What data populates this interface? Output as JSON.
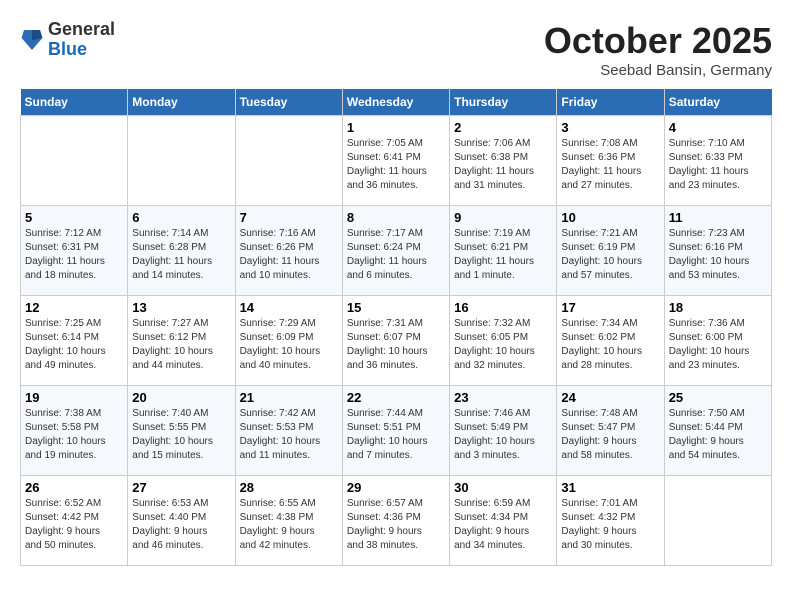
{
  "logo": {
    "general": "General",
    "blue": "Blue"
  },
  "header": {
    "month": "October 2025",
    "location": "Seebad Bansin, Germany"
  },
  "days_of_week": [
    "Sunday",
    "Monday",
    "Tuesday",
    "Wednesday",
    "Thursday",
    "Friday",
    "Saturday"
  ],
  "weeks": [
    [
      {
        "day": "",
        "info": ""
      },
      {
        "day": "",
        "info": ""
      },
      {
        "day": "",
        "info": ""
      },
      {
        "day": "1",
        "info": "Sunrise: 7:05 AM\nSunset: 6:41 PM\nDaylight: 11 hours\nand 36 minutes."
      },
      {
        "day": "2",
        "info": "Sunrise: 7:06 AM\nSunset: 6:38 PM\nDaylight: 11 hours\nand 31 minutes."
      },
      {
        "day": "3",
        "info": "Sunrise: 7:08 AM\nSunset: 6:36 PM\nDaylight: 11 hours\nand 27 minutes."
      },
      {
        "day": "4",
        "info": "Sunrise: 7:10 AM\nSunset: 6:33 PM\nDaylight: 11 hours\nand 23 minutes."
      }
    ],
    [
      {
        "day": "5",
        "info": "Sunrise: 7:12 AM\nSunset: 6:31 PM\nDaylight: 11 hours\nand 18 minutes."
      },
      {
        "day": "6",
        "info": "Sunrise: 7:14 AM\nSunset: 6:28 PM\nDaylight: 11 hours\nand 14 minutes."
      },
      {
        "day": "7",
        "info": "Sunrise: 7:16 AM\nSunset: 6:26 PM\nDaylight: 11 hours\nand 10 minutes."
      },
      {
        "day": "8",
        "info": "Sunrise: 7:17 AM\nSunset: 6:24 PM\nDaylight: 11 hours\nand 6 minutes."
      },
      {
        "day": "9",
        "info": "Sunrise: 7:19 AM\nSunset: 6:21 PM\nDaylight: 11 hours\nand 1 minute."
      },
      {
        "day": "10",
        "info": "Sunrise: 7:21 AM\nSunset: 6:19 PM\nDaylight: 10 hours\nand 57 minutes."
      },
      {
        "day": "11",
        "info": "Sunrise: 7:23 AM\nSunset: 6:16 PM\nDaylight: 10 hours\nand 53 minutes."
      }
    ],
    [
      {
        "day": "12",
        "info": "Sunrise: 7:25 AM\nSunset: 6:14 PM\nDaylight: 10 hours\nand 49 minutes."
      },
      {
        "day": "13",
        "info": "Sunrise: 7:27 AM\nSunset: 6:12 PM\nDaylight: 10 hours\nand 44 minutes."
      },
      {
        "day": "14",
        "info": "Sunrise: 7:29 AM\nSunset: 6:09 PM\nDaylight: 10 hours\nand 40 minutes."
      },
      {
        "day": "15",
        "info": "Sunrise: 7:31 AM\nSunset: 6:07 PM\nDaylight: 10 hours\nand 36 minutes."
      },
      {
        "day": "16",
        "info": "Sunrise: 7:32 AM\nSunset: 6:05 PM\nDaylight: 10 hours\nand 32 minutes."
      },
      {
        "day": "17",
        "info": "Sunrise: 7:34 AM\nSunset: 6:02 PM\nDaylight: 10 hours\nand 28 minutes."
      },
      {
        "day": "18",
        "info": "Sunrise: 7:36 AM\nSunset: 6:00 PM\nDaylight: 10 hours\nand 23 minutes."
      }
    ],
    [
      {
        "day": "19",
        "info": "Sunrise: 7:38 AM\nSunset: 5:58 PM\nDaylight: 10 hours\nand 19 minutes."
      },
      {
        "day": "20",
        "info": "Sunrise: 7:40 AM\nSunset: 5:55 PM\nDaylight: 10 hours\nand 15 minutes."
      },
      {
        "day": "21",
        "info": "Sunrise: 7:42 AM\nSunset: 5:53 PM\nDaylight: 10 hours\nand 11 minutes."
      },
      {
        "day": "22",
        "info": "Sunrise: 7:44 AM\nSunset: 5:51 PM\nDaylight: 10 hours\nand 7 minutes."
      },
      {
        "day": "23",
        "info": "Sunrise: 7:46 AM\nSunset: 5:49 PM\nDaylight: 10 hours\nand 3 minutes."
      },
      {
        "day": "24",
        "info": "Sunrise: 7:48 AM\nSunset: 5:47 PM\nDaylight: 9 hours\nand 58 minutes."
      },
      {
        "day": "25",
        "info": "Sunrise: 7:50 AM\nSunset: 5:44 PM\nDaylight: 9 hours\nand 54 minutes."
      }
    ],
    [
      {
        "day": "26",
        "info": "Sunrise: 6:52 AM\nSunset: 4:42 PM\nDaylight: 9 hours\nand 50 minutes."
      },
      {
        "day": "27",
        "info": "Sunrise: 6:53 AM\nSunset: 4:40 PM\nDaylight: 9 hours\nand 46 minutes."
      },
      {
        "day": "28",
        "info": "Sunrise: 6:55 AM\nSunset: 4:38 PM\nDaylight: 9 hours\nand 42 minutes."
      },
      {
        "day": "29",
        "info": "Sunrise: 6:57 AM\nSunset: 4:36 PM\nDaylight: 9 hours\nand 38 minutes."
      },
      {
        "day": "30",
        "info": "Sunrise: 6:59 AM\nSunset: 4:34 PM\nDaylight: 9 hours\nand 34 minutes."
      },
      {
        "day": "31",
        "info": "Sunrise: 7:01 AM\nSunset: 4:32 PM\nDaylight: 9 hours\nand 30 minutes."
      },
      {
        "day": "",
        "info": ""
      }
    ]
  ]
}
